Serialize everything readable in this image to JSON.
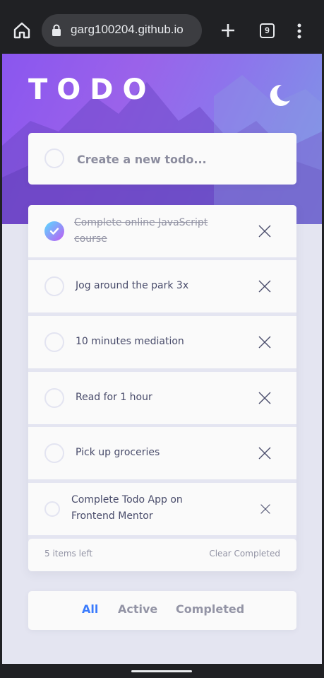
{
  "browser": {
    "url": "garg100204.github.io",
    "tab_count": "9",
    "icons": [
      "home-icon",
      "lock-icon",
      "new-tab-icon",
      "tabs-icon",
      "more-menu-icon"
    ]
  },
  "app": {
    "title": "TODO",
    "theme_icon": "moon-icon",
    "create": {
      "placeholder": "Create a new todo..."
    },
    "todos": [
      {
        "text": "Complete online JavaScript course",
        "completed": true
      },
      {
        "text": "Jog around the park 3x",
        "completed": false
      },
      {
        "text": "10 minutes mediation",
        "completed": false
      },
      {
        "text": "Read for 1 hour",
        "completed": false
      },
      {
        "text": "Pick up groceries",
        "completed": false
      },
      {
        "text": "Complete Todo App on Frontend Mentor",
        "completed": false
      }
    ],
    "footer": {
      "items_left": "5 items left",
      "clear_label": "Clear Completed"
    },
    "filters": [
      {
        "label": "All",
        "active": true
      },
      {
        "label": "Active",
        "active": false
      },
      {
        "label": "Completed",
        "active": false
      }
    ],
    "colors": {
      "accent": "#3a7bfd",
      "check_gradient_start": "#57ddff",
      "check_gradient_end": "#c058f3",
      "text": "#484b6a",
      "muted": "#9394a5"
    }
  }
}
